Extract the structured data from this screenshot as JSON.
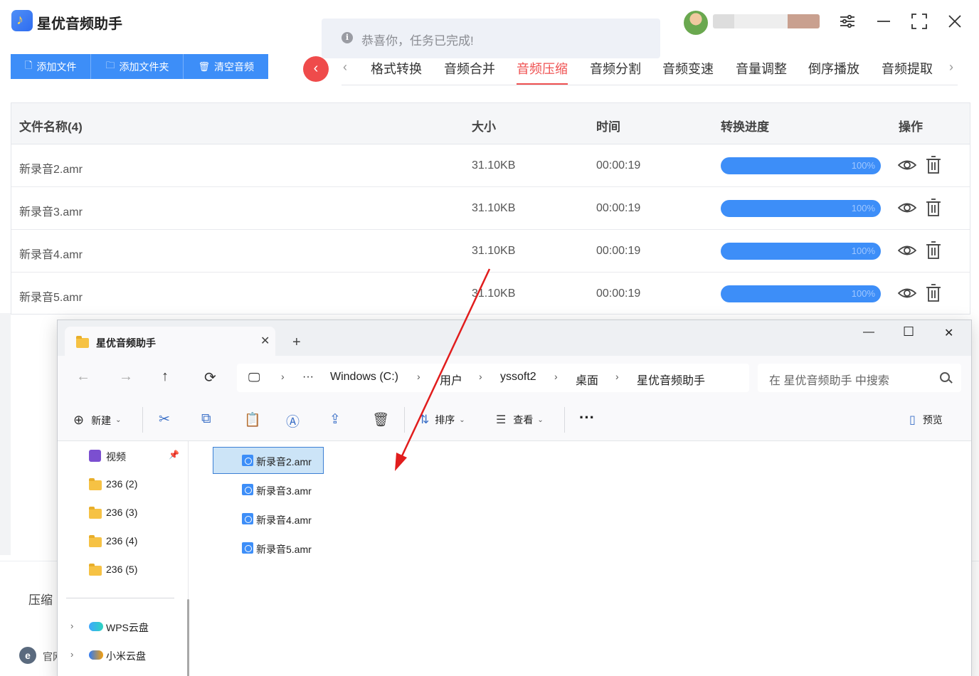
{
  "app": {
    "title": "星优音频助手",
    "toast": "恭喜你，任务已完成!",
    "toolbar": {
      "add_file": "添加文件",
      "add_folder": "添加文件夹",
      "clear_list": "清空音频"
    },
    "tabs": [
      "格式转换",
      "音频合并",
      "音频压缩",
      "音频分割",
      "音频变速",
      "音量调整",
      "倒序播放",
      "音频提取"
    ],
    "active_tab": "音频压缩",
    "table": {
      "headers": {
        "name": "文件名称(4)",
        "size": "大小",
        "time": "时间",
        "progress": "转换进度",
        "actions": "操作"
      },
      "rows": [
        {
          "name": "新录音2.amr",
          "size": "31.10KB",
          "time": "00:00:19",
          "progress": "100%"
        },
        {
          "name": "新录音3.amr",
          "size": "31.10KB",
          "time": "00:00:19",
          "progress": "100%"
        },
        {
          "name": "新录音4.amr",
          "size": "31.10KB",
          "time": "00:00:19",
          "progress": "100%"
        },
        {
          "name": "新录音5.amr",
          "size": "31.10KB",
          "time": "00:00:19",
          "progress": "100%"
        }
      ]
    },
    "bottom": {
      "compress_label": "压缩",
      "site_label": "官网"
    },
    "colors": {
      "accent": "#3d8ef8",
      "active_tab": "#ef5050",
      "back_button": "#ef4b4b"
    }
  },
  "explorer": {
    "tab_title": "星优音频助手",
    "breadcrumb": [
      "Windows (C:)",
      "用户",
      "yssoft2",
      "桌面",
      "星优音频助手"
    ],
    "search_placeholder": "在 星优音频助手 中搜索",
    "toolbar": {
      "new": "新建",
      "sort": "排序",
      "view": "查看",
      "preview": "预览"
    },
    "sidebar": {
      "items": [
        "视频",
        "236 (2)",
        "236 (3)",
        "236 (4)",
        "236 (5)"
      ],
      "cloud": [
        "WPS云盘",
        "小米云盘"
      ]
    },
    "files": [
      "新录音2.amr",
      "新录音3.amr",
      "新录音4.amr",
      "新录音5.amr"
    ],
    "selected_file": "新录音2.amr"
  }
}
